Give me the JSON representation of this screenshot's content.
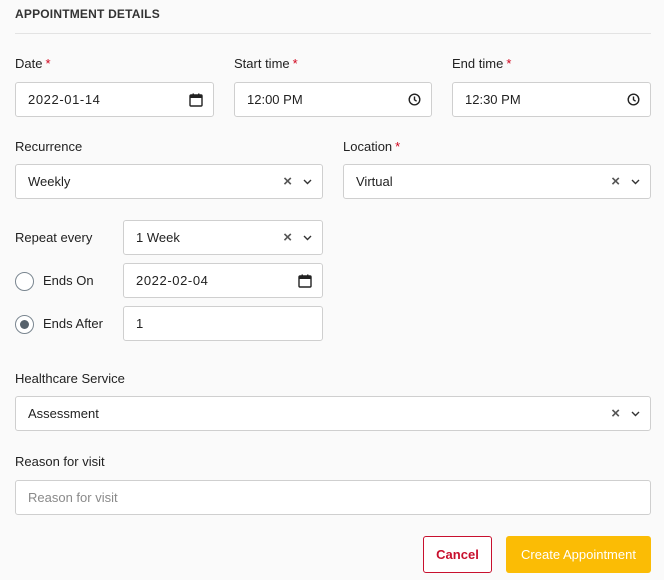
{
  "section": {
    "title": "APPOINTMENT DETAILS"
  },
  "required_mark": "*",
  "date": {
    "label": "Date",
    "value": "2022-01-14"
  },
  "start_time": {
    "label": "Start time",
    "value": "12:00 PM"
  },
  "end_time": {
    "label": "End time",
    "value": "12:30 PM"
  },
  "recurrence": {
    "label": "Recurrence",
    "value": "Weekly"
  },
  "location": {
    "label": "Location",
    "value": "Virtual"
  },
  "repeat_every": {
    "label": "Repeat every",
    "value": "1 Week"
  },
  "ends_on": {
    "label": "Ends On",
    "value": "2022-02-04",
    "checked": false
  },
  "ends_after": {
    "label": "Ends After",
    "value": "1",
    "checked": true
  },
  "healthcare_service": {
    "label": "Healthcare Service",
    "value": "Assessment"
  },
  "reason": {
    "label": "Reason for visit",
    "placeholder": "Reason for visit",
    "value": ""
  },
  "actions": {
    "cancel_label": "Cancel",
    "create_label": "Create Appointment"
  },
  "colors": {
    "required": "#d0021b",
    "cancel": "#c8102e",
    "primary": "#fbbc05"
  }
}
